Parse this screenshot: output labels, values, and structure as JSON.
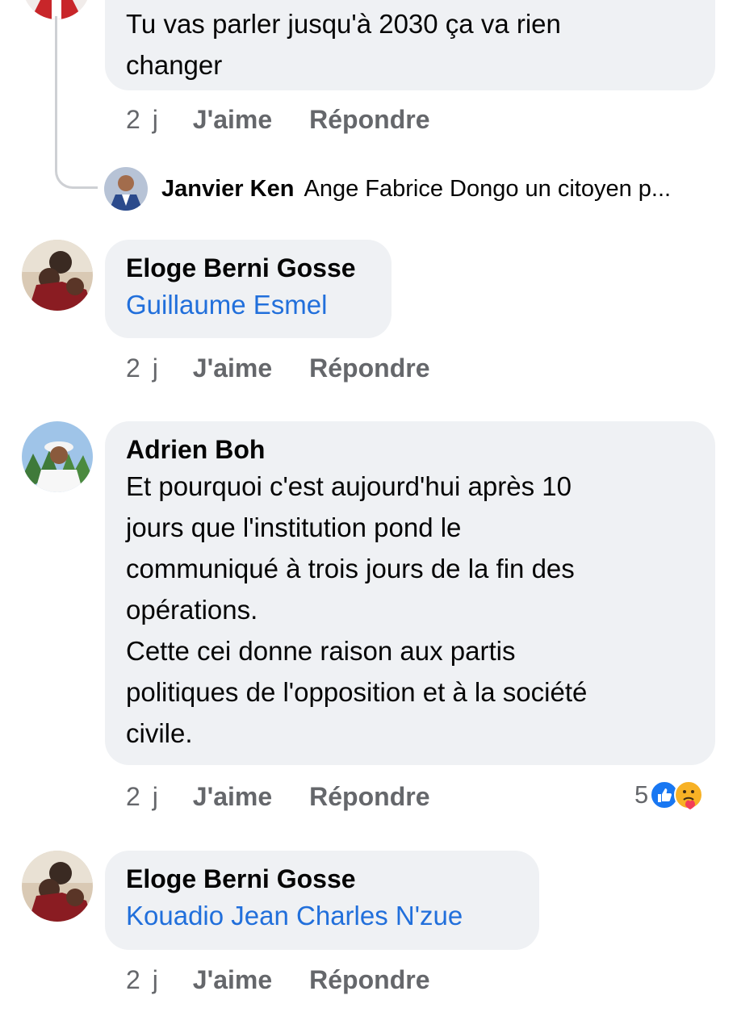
{
  "comments": [
    {
      "text": "Tu vas parler jusqu'à 2030 ça va rien\nchanger",
      "time": "2 j",
      "like_label": "J'aime",
      "reply_label": "Répondre"
    },
    {
      "author": "Eloge Berni Gosse",
      "mention": "Guillaume Esmel",
      "time": "2 j",
      "like_label": "J'aime",
      "reply_label": "Répondre"
    },
    {
      "author": "Adrien Boh",
      "text": "Et pourquoi c'est aujourd'hui après 10\njours que l'institution pond le\ncommuniqué à trois jours de la fin des\nopérations.\nCette cei donne raison aux partis\npolitiques de l'opposition et à la société\ncivile.",
      "time": "2 j",
      "like_label": "J'aime",
      "reply_label": "Répondre",
      "reaction_count": "5",
      "reactions": [
        "like-icon",
        "care-icon"
      ]
    },
    {
      "author": "Eloge Berni Gosse",
      "mention": "Kouadio Jean Charles N'zue",
      "time": "2 j",
      "like_label": "J'aime",
      "reply_label": "Répondre"
    }
  ],
  "reply_preview": {
    "author": "Janvier Ken",
    "text": "Ange Fabrice Dongo un citoyen p..."
  },
  "colors": {
    "bubble": "#eff1f4",
    "mention": "#216fdb",
    "meta": "#65676b",
    "like_blue": "#1877f2",
    "care_yellow": "#f7b125"
  }
}
